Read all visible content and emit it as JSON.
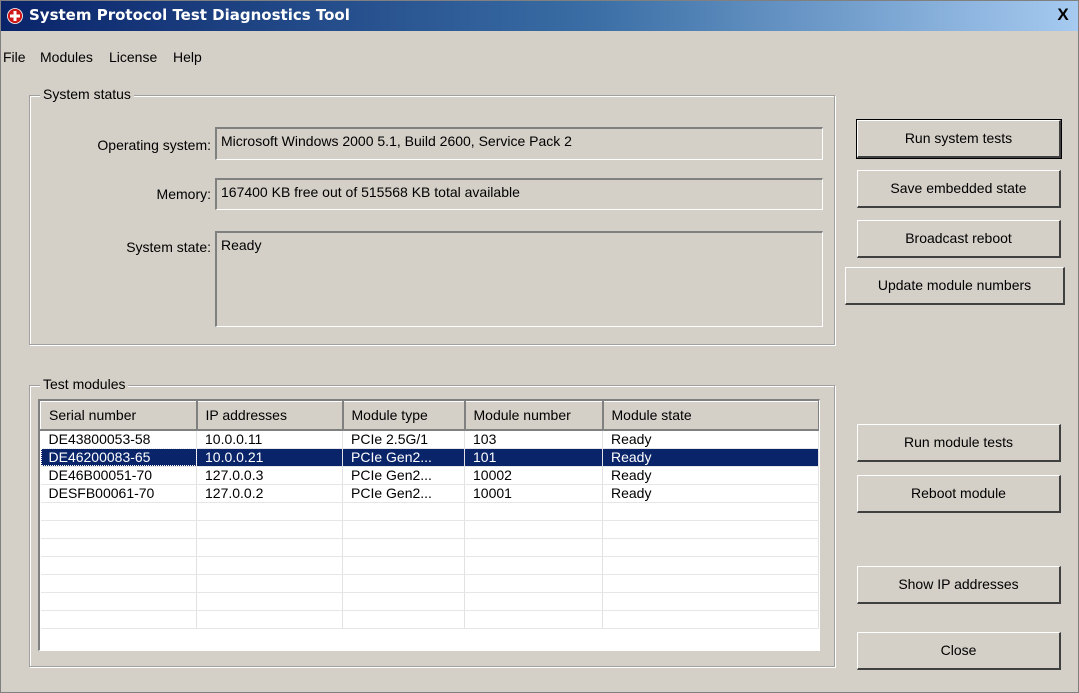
{
  "window": {
    "title": "System Protocol Test Diagnostics Tool",
    "close_glyph": "X",
    "icon": "red-cross-icon"
  },
  "menu": [
    "File",
    "Modules",
    "License",
    "Help"
  ],
  "system_status": {
    "legend": "System status",
    "os_label": "Operating system:",
    "os_value": "Microsoft Windows 2000 5.1,  Build 2600, Service Pack 2",
    "memory_label": "Memory:",
    "memory_value": "167400 KB free out of 515568 KB total available",
    "state_label": "System state:",
    "state_value": "Ready"
  },
  "buttons": {
    "run_system_tests": "Run system tests",
    "save_embedded_state": "Save embedded state",
    "broadcast_reboot": "Broadcast reboot",
    "update_module_numbers": "Update module numbers",
    "run_module_tests": "Run module tests",
    "reboot_module": "Reboot module",
    "show_ip_addresses": "Show IP addresses",
    "close": "Close"
  },
  "test_modules": {
    "legend": "Test modules",
    "columns": [
      "Serial number",
      "IP addresses",
      "Module type",
      "Module number",
      "Module state"
    ],
    "rows": [
      [
        "DE43800053-58",
        "10.0.0.11",
        "PCIe 2.5G/1",
        "103",
        "Ready"
      ],
      [
        "DE46200083-65",
        "10.0.0.21",
        "PCIe Gen2...",
        "101",
        "Ready"
      ],
      [
        "DE46B00051-70",
        "127.0.0.3",
        "PCIe Gen2...",
        "10002",
        "Ready"
      ],
      [
        "DESFB00061-70",
        "127.0.0.2",
        "PCIe Gen2...",
        "10001",
        "Ready"
      ]
    ],
    "selected_row": 1
  },
  "colors": {
    "window_bg": "#d4d0c8",
    "title_start": "#0a246a",
    "title_end": "#a6caf0",
    "selection": "#0a246a"
  }
}
